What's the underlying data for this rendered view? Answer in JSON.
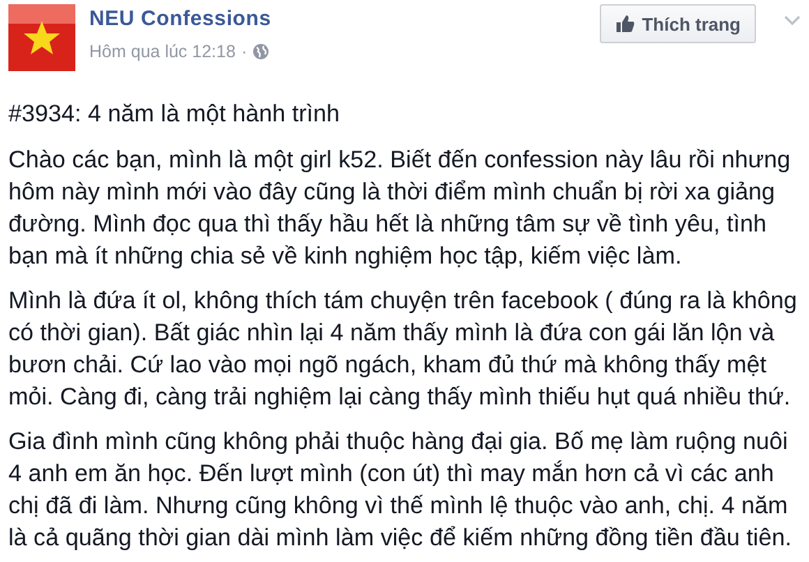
{
  "page": {
    "name": "NEU Confessions",
    "time": "Hôm qua lúc 12:18",
    "separator": "·"
  },
  "like_button": {
    "label": "Thích trang"
  },
  "post": {
    "title": "#3934: 4 năm là một hành trình",
    "paragraphs": [
      "Chào các bạn, mình là một girl k52. Biết đến confession này lâu rồi nhưng hôm này mình mới vào đây cũng là thời điểm mình chuẩn bị rời xa giảng đường. Mình đọc qua thì thấy hầu hết là những tâm sự về tình yêu, tình bạn mà ít những chia sẻ về kinh nghiệm học tập, kiếm việc làm.",
      "Mình là đứa ít ol, không thích tám chuyện trên facebook ( đúng ra là không có thời gian). Bất giác nhìn lại 4 năm thấy mình là đứa con gái lăn lộn và bươn chải. Cứ lao vào mọi ngõ ngách, kham đủ thứ mà không thấy mệt mỏi. Càng đi, càng trải nghiệm lại càng thấy mình thiếu hụt quá nhiều thứ.",
      "Gia đình mình cũng không phải thuộc hàng đại gia. Bố mẹ làm ruộng nuôi 4 anh em ăn học. Đến lượt mình (con út) thì may mắn hơn cả vì các anh chị đã đi làm. Nhưng cũng không vì thế mình lệ thuộc vào anh, chị. 4 năm là cả quãng thời gian dài mình làm việc để kiếm những đồng tiền đầu tiên."
    ]
  }
}
